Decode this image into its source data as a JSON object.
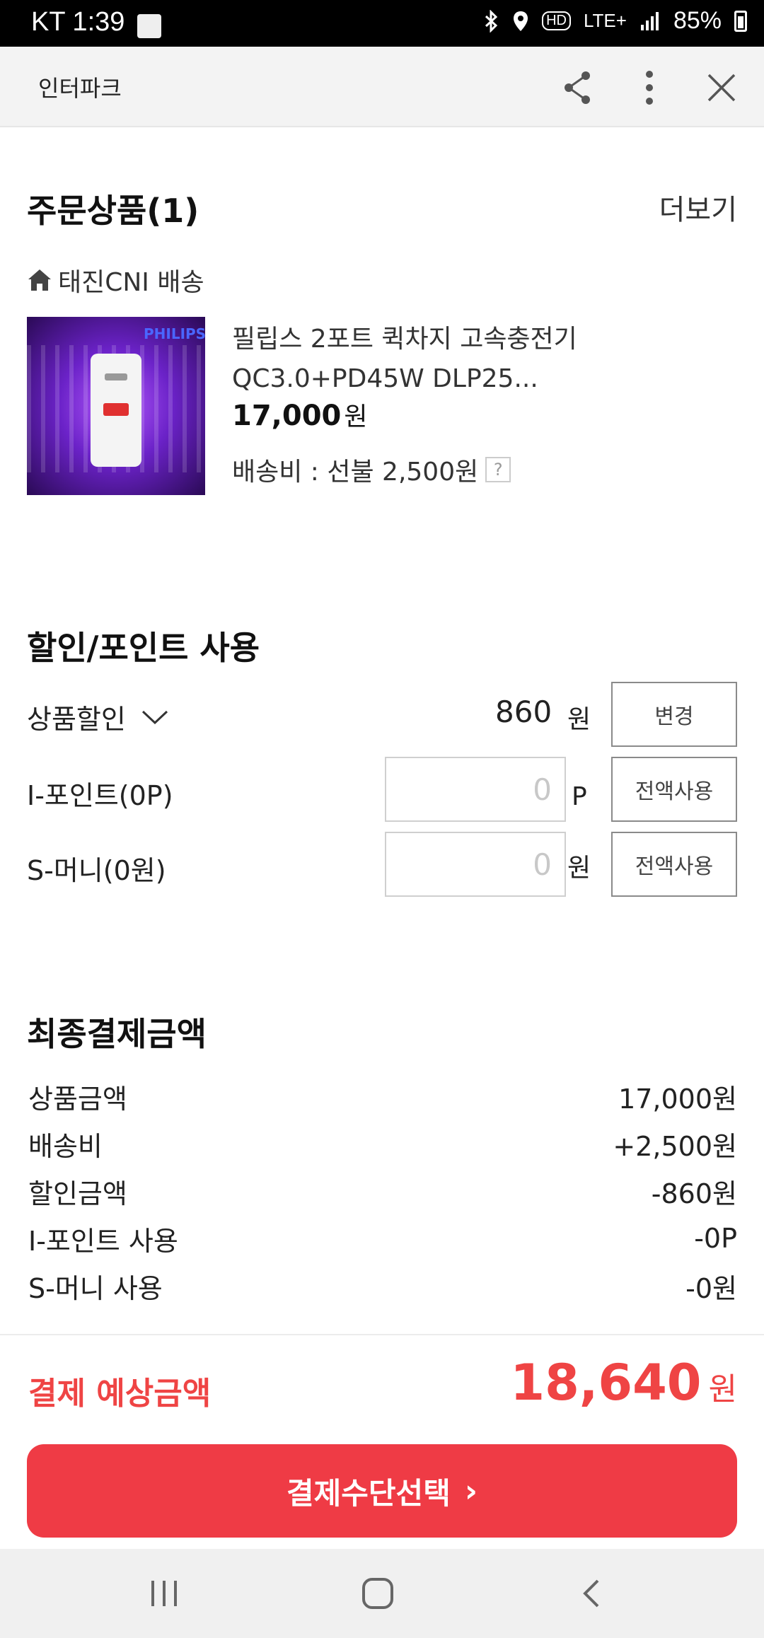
{
  "status_bar": {
    "carrier_time": "KT 1:39",
    "battery": "85%",
    "network": "LTE+"
  },
  "app_bar": {
    "title": "인터파크",
    "icons": [
      "share-icon",
      "more-vert-icon",
      "close-icon"
    ]
  },
  "order": {
    "title": "주문상품(1)",
    "more_label": "더보기",
    "seller": "태진CNI 배송",
    "product": {
      "thumb_brand": "PHILIPS",
      "name_line1": "필립스 2포트 퀵차지 고속충전기",
      "name_line2": "QC3.0+PD45W DLP25...",
      "price": "17,000",
      "price_unit": "원",
      "shipping": "배송비 : 선불 2,500원",
      "help": "?"
    }
  },
  "discount": {
    "title": "할인/포인트 사용",
    "product_discount_label": "상품할인",
    "product_discount_value": "860",
    "product_discount_unit": "원",
    "change_button": "변경",
    "ipoint_label": "I-포인트(0P)",
    "ipoint_placeholder": "0",
    "ipoint_unit": "P",
    "ipoint_button": "전액사용",
    "smoney_label": "S-머니(0원)",
    "smoney_placeholder": "0",
    "smoney_unit": "원",
    "smoney_button": "전액사용"
  },
  "summary": {
    "title": "최종결제금액",
    "rows": [
      {
        "label": "상품금액",
        "value": "17,000원"
      },
      {
        "label": "배송비",
        "value": "+2,500원"
      },
      {
        "label": "할인금액",
        "value": "-860원"
      },
      {
        "label": "I-포인트 사용",
        "value": "-0P"
      },
      {
        "label": "S-머니 사용",
        "value": "-0원"
      }
    ],
    "expected_label": "결제 예상금액",
    "expected_amount": "18,640",
    "expected_unit": "원"
  },
  "cta": {
    "label": "결제수단선택",
    "chevron": "›"
  },
  "colors": {
    "accent": "#ef3b45",
    "accent_text": "#ef4444"
  }
}
